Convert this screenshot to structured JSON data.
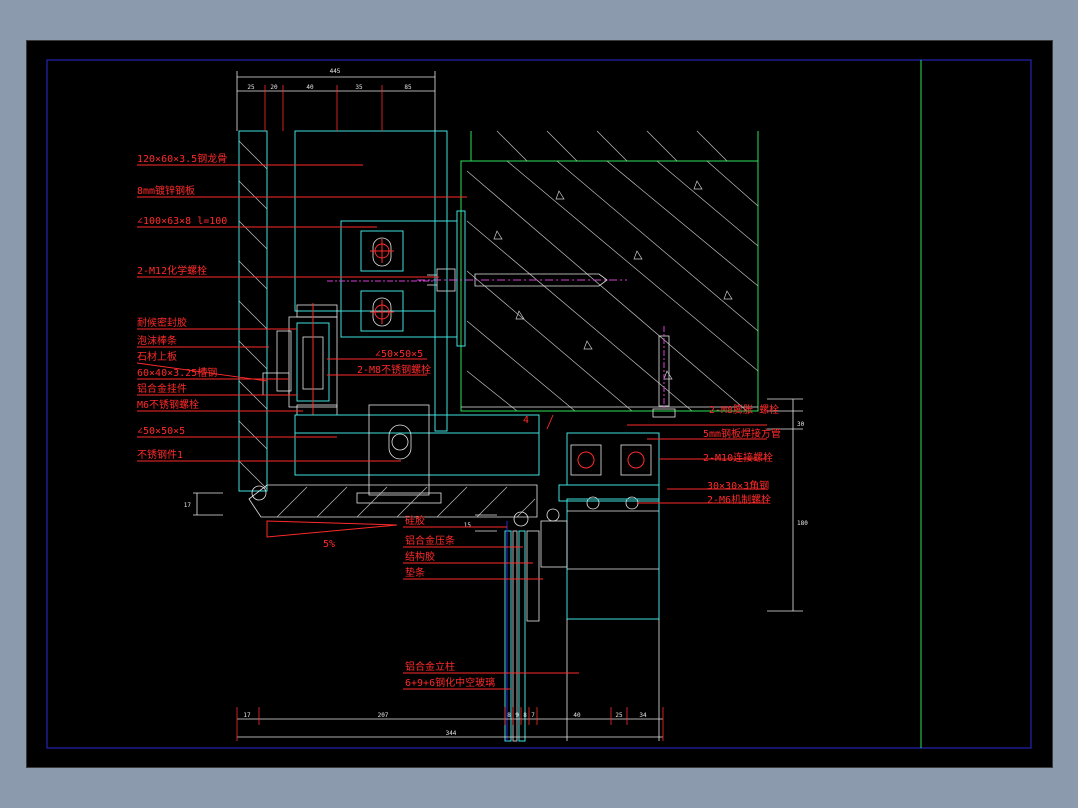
{
  "drawing": {
    "labels": {
      "steel_tube": "120×60×3.5钢龙骨",
      "plate_8mm": "8mm镀锌钢板",
      "angle_100": "∠100×63×8  l=100",
      "chem_bolt": "2-M12化学螺栓",
      "sealant": "耐候密封胶",
      "foam_strip": "泡沫棒条",
      "stone_board": "石材上板",
      "channel_60": "60×40×3.25槽钢",
      "alloy_hook": "铝合金挂件",
      "ss_bolt": "M6不锈钢螺栓",
      "angle_50_a": "∠50×50×5",
      "ss_bolt_a": "2-M8不锈钢螺栓",
      "angle_50_b": "∠50×50×5",
      "ss_part": "不锈钢件1",
      "expansion_bolt": "2-M8膨胀 螺栓",
      "plate_5mm": "5mm钢板焊接方管",
      "bolt_m10": "2-M10连接螺栓",
      "angle_30": "30×30×3角钢",
      "bolt_m6_a": "2-M6机制螺栓",
      "glue": "硅胶",
      "alloy_frame": "铝合金压条",
      "struct_glue": "结构胶",
      "pad": "垫条",
      "mullion": "铝合金立柱",
      "glass": "6+9+6钢化中空玻璃",
      "slope": "5%",
      "pointer_4": "4"
    },
    "dims_top": {
      "total": "445",
      "segments": [
        "25",
        "20",
        "40",
        "35",
        "85"
      ]
    },
    "dims_bottom": {
      "total": "344",
      "segments": [
        "17",
        "207",
        "8",
        "9",
        "8",
        "7",
        "40",
        "25",
        "34"
      ]
    },
    "dims_side": {
      "left": "17",
      "left_small": "15",
      "right_small": "30",
      "right_big": "180"
    }
  },
  "colors": {
    "background": "#000000",
    "annotation": "#ff2a2a",
    "structure": "#3fe0e0",
    "concrete": "#2fe05a",
    "frame": "#2a2ad8"
  }
}
